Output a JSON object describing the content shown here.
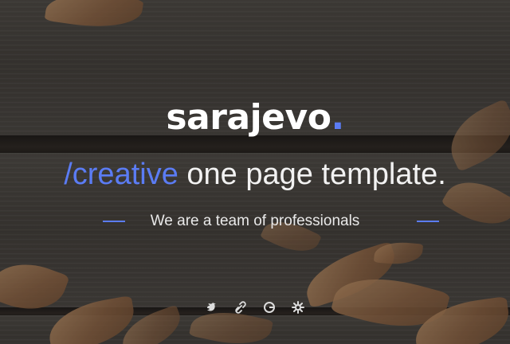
{
  "hero": {
    "brand": {
      "name": "sarajevo",
      "dot": "."
    },
    "tagline": {
      "accent": "/creative",
      "rest": " one page template."
    },
    "subline": "We are a team of professionals"
  },
  "social_icons": [
    "bird-icon",
    "link-icon",
    "github-icon",
    "gear-icon"
  ],
  "colors": {
    "accent": "#5b7cf4",
    "text": "#ffffff"
  }
}
